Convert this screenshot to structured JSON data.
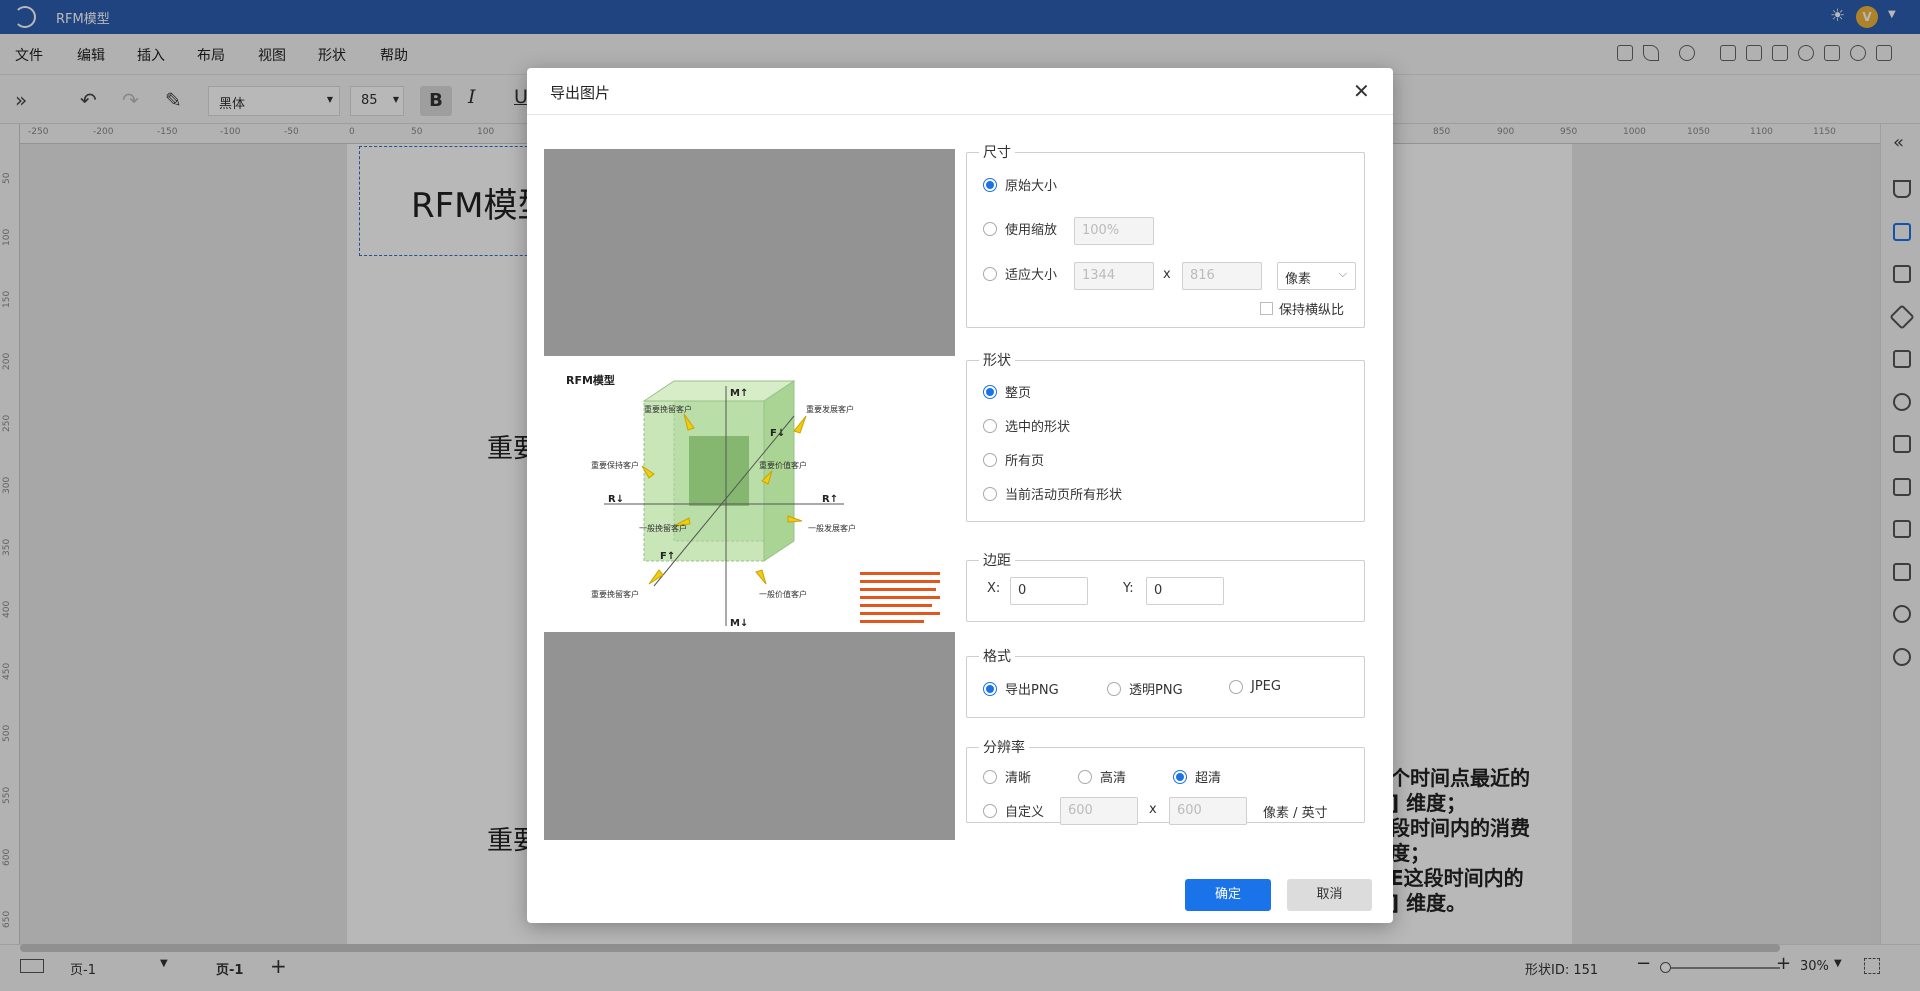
{
  "app": {
    "title": "RFM模型"
  },
  "menu": {
    "file": "文件",
    "edit": "编辑",
    "insert": "插入",
    "layout": "布局",
    "view": "视图",
    "shape": "形状",
    "help": "帮助"
  },
  "toolbar": {
    "font": "黑体",
    "font_size": "85",
    "bold": "B",
    "italic": "I",
    "underline": "U"
  },
  "ruler": {
    "top_labels": [
      "-250",
      "-200",
      "-150",
      "-100",
      "-50",
      "0",
      "50",
      "100",
      "850",
      "900",
      "950",
      "1000",
      "1050",
      "1100",
      "1150"
    ],
    "left_labels": [
      "50",
      "100",
      "150",
      "200",
      "250",
      "300",
      "350",
      "400",
      "450",
      "500",
      "550",
      "600",
      "650"
    ]
  },
  "canvas": {
    "title": "RFM模型",
    "left_text_1": "重要",
    "left_text_2": "重要",
    "right_lines": [
      "个时间点最近的",
      "] 维度；",
      "段时间内的消费",
      "度；",
      "E这段时间内的",
      "] 维度。"
    ]
  },
  "dialog": {
    "title": "导出图片",
    "size_section": {
      "legend": "尺寸",
      "original": "原始大小",
      "scale": "使用缩放",
      "scale_value": "100%",
      "fit": "适应大小",
      "width": "1344",
      "x": "x",
      "height": "816",
      "unit": "像素",
      "keep_ratio": "保持横纵比"
    },
    "shape_section": {
      "legend": "形状",
      "whole_page": "整页",
      "selected": "选中的形状",
      "all_pages": "所有页",
      "active_page_all": "当前活动页所有形状"
    },
    "margin_section": {
      "legend": "边距",
      "x_label": "X:",
      "x_value": "0",
      "y_label": "Y:",
      "y_value": "0"
    },
    "format_section": {
      "legend": "格式",
      "png": "导出PNG",
      "transparent_png": "透明PNG",
      "jpeg": "JPEG"
    },
    "resolution_section": {
      "legend": "分辨率",
      "clear": "清晰",
      "hd": "高清",
      "uhd": "超清",
      "custom": "自定义",
      "w": "600",
      "x": "x",
      "h": "600",
      "unit": "像素 / 英寸"
    },
    "ok": "确定",
    "cancel": "取消"
  },
  "preview": {
    "title": "RFM模型",
    "labels": [
      "重要挽留客户",
      "重要发展客户",
      "重要保持客户",
      "重要价值客户",
      "一般挽留客户",
      "一般发展客户",
      "重要挽留客户",
      "一般价值客户"
    ],
    "axes": [
      "M↑",
      "F↓",
      "R↓",
      "R↑",
      "F↑",
      "M↓"
    ]
  },
  "bottom": {
    "page_select": "页-1",
    "page_tab": "页-1",
    "add": "+",
    "shape_id": "形状ID: 151",
    "zoom": "30%"
  },
  "colors": {
    "accent": "#1a73e8",
    "titlebar": "#2d5fb0"
  }
}
